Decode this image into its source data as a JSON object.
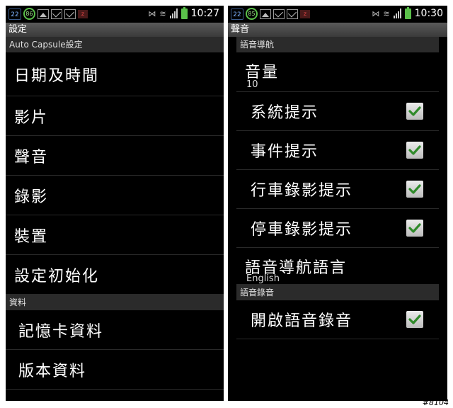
{
  "left": {
    "status": {
      "badge": "22",
      "battery_level": "86",
      "time": "10:27"
    },
    "title": "設定",
    "section1": "Auto Capsule設定",
    "items1": [
      "日期及時間",
      "影片",
      "聲音",
      "錄影",
      "裝置",
      "設定初始化"
    ],
    "section2": "資料",
    "items2": [
      "記憶卡資料",
      "版本資料"
    ]
  },
  "right": {
    "status": {
      "badge": "22",
      "battery_level": "85",
      "time": "10:30"
    },
    "title": "聲音",
    "section1": "語音導航",
    "volume": {
      "label": "音量",
      "value": "10"
    },
    "checks": [
      {
        "label": "系統提示",
        "checked": true
      },
      {
        "label": "事件提示",
        "checked": true
      },
      {
        "label": "行車錄影提示",
        "checked": true
      },
      {
        "label": "停車錄影提示",
        "checked": true
      }
    ],
    "language": {
      "label": "語音導航語言",
      "value": "English"
    },
    "section2": "語音錄音",
    "record": {
      "label": "開啟語音錄音",
      "checked": true
    }
  },
  "watermark": "#8104",
  "colors": {
    "check": "#2f8a2a",
    "battery": "#5ac04a"
  }
}
